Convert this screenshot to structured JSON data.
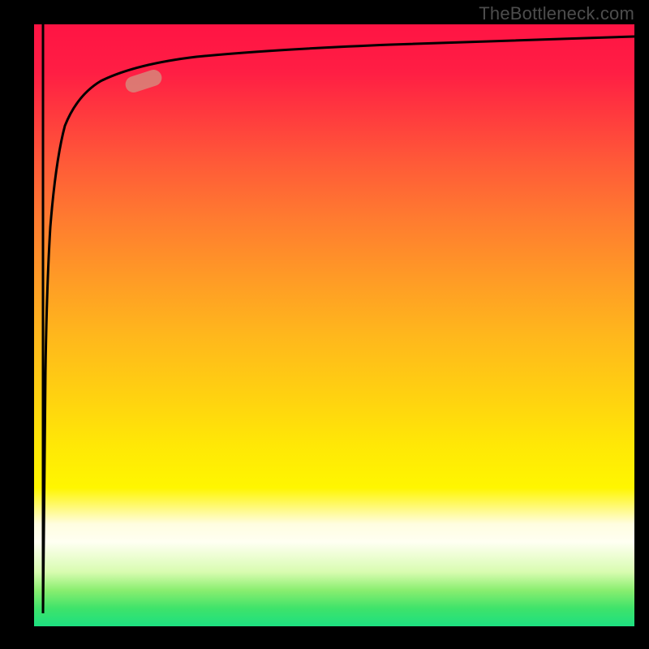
{
  "watermark": "TheBottleneck.com",
  "colors": {
    "frame": "#000000",
    "curve": "#000000",
    "marker": "#d68a7c",
    "gradient_top": "#ff1444",
    "gradient_bottom": "#1de080"
  },
  "chart_data": {
    "type": "line",
    "title": "",
    "xlabel": "",
    "ylabel": "",
    "xlim": [
      0,
      100
    ],
    "ylim": [
      0,
      100
    ],
    "grid": false,
    "legend": false,
    "note": "Axes and tick labels are not rendered in the source image; values are estimated positions on a 0-100 normalized scale read from the plot area.",
    "series": [
      {
        "name": "curve",
        "x": [
          1.5,
          1.6,
          1.8,
          2.0,
          2.3,
          2.7,
          3.2,
          4.0,
          5.0,
          6.5,
          8.5,
          11,
          14,
          18,
          23,
          30,
          40,
          55,
          75,
          100
        ],
        "y": [
          2,
          12,
          28,
          42,
          55,
          65,
          73,
          79,
          83,
          86,
          88.5,
          90,
          91.3,
          92.3,
          93.1,
          93.8,
          94.5,
          95.3,
          96.0,
          96.5
        ]
      }
    ],
    "annotations": [
      {
        "name": "highlight-marker",
        "x": 18,
        "y": 90.5,
        "shape": "pill",
        "angle_deg": -18
      }
    ]
  }
}
